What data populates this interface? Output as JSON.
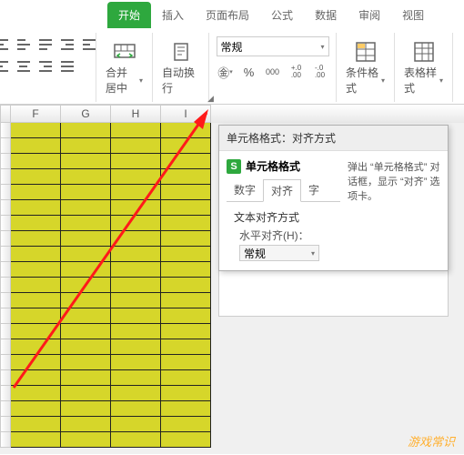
{
  "tabs": {
    "start": "开始",
    "insert": "插入",
    "layout": "页面布局",
    "formula": "公式",
    "data": "数据",
    "review": "审阅",
    "view": "视图"
  },
  "ribbon": {
    "merge": "合并居中",
    "wrap": "自动换行",
    "numfmt": {
      "selected": "常规",
      "currency": "¥",
      "percent": "%",
      "comma": "000",
      "thousand": "000",
      "dec_inc": ".0 →.00",
      "dec_dec": ".00 →.0"
    },
    "cond": "条件格式",
    "tblstyle": "表格样式"
  },
  "cols": [
    "F",
    "G",
    "H",
    "I"
  ],
  "tip": {
    "header": "单元格格式：对齐方式",
    "title": "单元格格式",
    "subtabs": {
      "num": "数字",
      "align": "对齐",
      "font": "字"
    },
    "sect_title": "文本对齐方式",
    "halign_label": "水平对齐(H)：",
    "halign_value": "常规",
    "desc": "弹出 “单元格格式” 对话框，显示 “对齐” 选项卡。"
  },
  "watermark": "游戏常识"
}
